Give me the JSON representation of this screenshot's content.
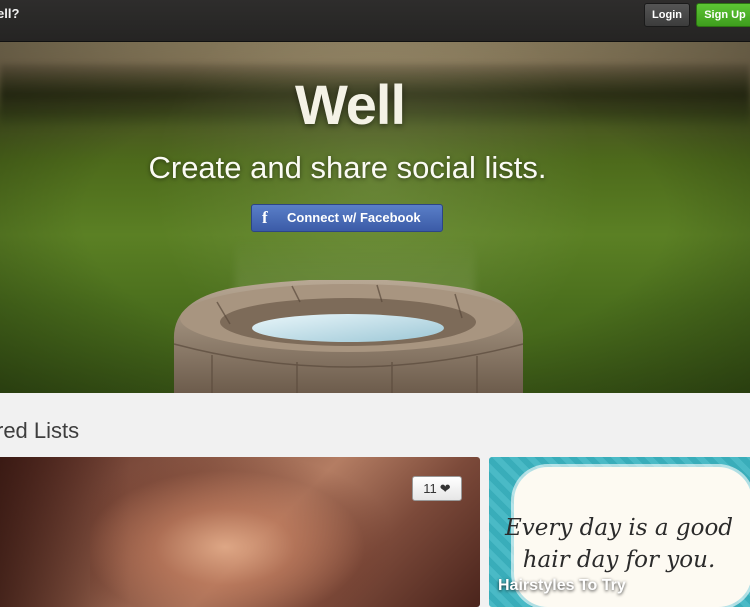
{
  "header": {
    "brand": "ell?",
    "login_label": "Login",
    "signup_label": "Sign Up"
  },
  "hero": {
    "logo": "Well",
    "tagline": "Create and share social lists.",
    "facebook_button": "Connect w/ Facebook",
    "facebook_icon": "facebook-f-icon"
  },
  "featured": {
    "title": "red Lists",
    "cards": [
      {
        "count": "11",
        "icon": "heart-icon"
      },
      {
        "quote": "Every day is a good hair day for you.",
        "caption": "Hairstyles To Try"
      }
    ]
  },
  "colors": {
    "signup_green": "#4caf2a",
    "facebook_blue": "#3b5ba7",
    "topbar_dark": "#2a2928"
  }
}
